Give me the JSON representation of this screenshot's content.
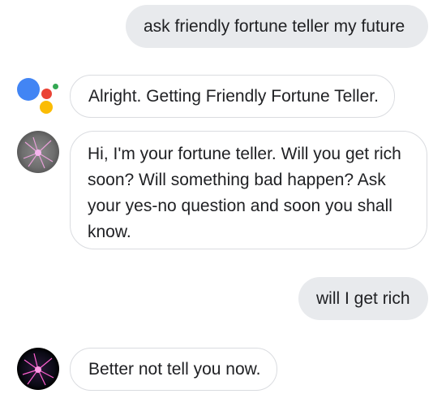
{
  "conversation": {
    "messages": [
      {
        "sender": "user",
        "text": "ask friendly fortune teller my future"
      },
      {
        "sender": "assistant",
        "text": "Alright. Getting Friendly Fortune Teller."
      },
      {
        "sender": "fortune-teller",
        "text": "Hi, I'm your fortune teller. Will you get rich soon? Will something bad happen? Ask your yes-no question and soon you shall know."
      },
      {
        "sender": "user",
        "text": "will I get rich"
      },
      {
        "sender": "fortune-teller",
        "text": "Better not tell you now."
      }
    ]
  },
  "colors": {
    "user_bubble": "#e8eaed",
    "bot_border": "#dadce0",
    "text": "#202124",
    "assistant_blue": "#4285f4",
    "assistant_red": "#ea4335",
    "assistant_yellow": "#fbbc04",
    "assistant_green": "#34a853"
  },
  "icons": {
    "assistant": "google-assistant-icon",
    "fortune_teller": "plasma-ball-avatar"
  }
}
